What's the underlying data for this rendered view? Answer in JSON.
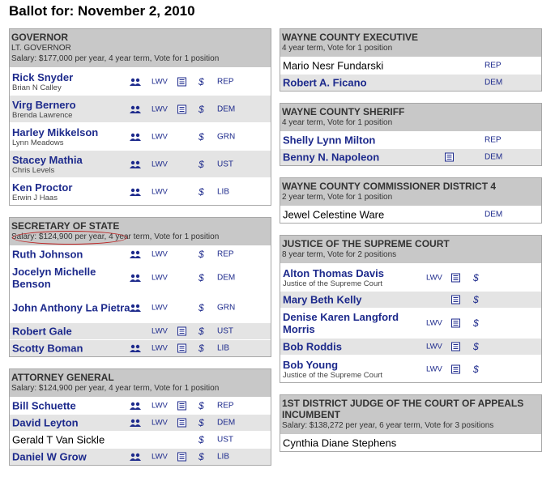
{
  "page_title": "Ballot for: November 2, 2010",
  "colors": {
    "link": "#1d2a8c",
    "header_bg": "#c8c8c8",
    "alt_row": "#e4e4e4",
    "annotation": "#bb2222"
  },
  "icons": {
    "people": "people-icon",
    "doc": "document-icon",
    "dollar": "$",
    "lwv": "LWV"
  },
  "left": [
    {
      "title": "GOVERNOR",
      "title2": "LT. GOVERNOR",
      "info": "Salary: $177,000 per year, 4 year term, Vote for 1 position",
      "candidates": [
        {
          "name": "Rick Snyder",
          "running": "Brian N Calley",
          "party": "REP",
          "lwv": "LWV",
          "dollar": "$"
        },
        {
          "name": "Virg Bernero",
          "running": "Brenda Lawrence",
          "party": "DEM",
          "lwv": "LWV",
          "dollar": "$"
        },
        {
          "name": "Harley Mikkelson",
          "running": "Lynn Meadows",
          "party": "GRN",
          "lwv": "LWV",
          "dollar": "$"
        },
        {
          "name": "Stacey Mathia",
          "running": "Chris Levels",
          "party": "UST",
          "lwv": "LWV",
          "dollar": "$"
        },
        {
          "name": "Ken Proctor",
          "running": "Erwin J Haas",
          "party": "LIB",
          "lwv": "LWV",
          "dollar": "$"
        }
      ]
    },
    {
      "title": "SECRETARY OF STATE",
      "info": "Salary: $124,900 per year, 4 year term, Vote for 1 position",
      "candidates": [
        {
          "name": "Ruth Johnson",
          "party": "REP",
          "lwv": "LWV",
          "dollar": "$"
        },
        {
          "name": "Jocelyn Michelle Benson",
          "party": "DEM",
          "lwv": "LWV",
          "dollar": "$"
        },
        {
          "name": "John Anthony La Pietra",
          "party": "GRN",
          "lwv": "LWV",
          "dollar": "$"
        },
        {
          "name": "Robert Gale",
          "party": "UST",
          "lwv": "LWV",
          "dollar": "$"
        },
        {
          "name": "Scotty Boman",
          "party": "LIB",
          "lwv": "LWV",
          "dollar": "$"
        }
      ]
    },
    {
      "title": "ATTORNEY GENERAL",
      "info": "Salary: $124,900 per year, 4 year term, Vote for 1 position",
      "candidates": [
        {
          "name": "Bill Schuette",
          "party": "REP",
          "lwv": "LWV",
          "dollar": "$"
        },
        {
          "name": "David Leyton",
          "party": "DEM",
          "lwv": "LWV",
          "dollar": "$"
        },
        {
          "name": "Gerald T Van Sickle",
          "party": "UST",
          "dollar": "$"
        },
        {
          "name": "Daniel W Grow",
          "party": "LIB",
          "lwv": "LWV",
          "dollar": "$"
        }
      ]
    }
  ],
  "right": [
    {
      "title": "WAYNE COUNTY EXECUTIVE",
      "info": "4 year term, Vote for 1 position",
      "candidates": [
        {
          "name": "Mario Nesr Fundarski",
          "party": "REP"
        },
        {
          "name": "Robert A. Ficano",
          "party": "DEM"
        }
      ]
    },
    {
      "title": "WAYNE COUNTY SHERIFF",
      "info": "4 year term, Vote for 1 position",
      "candidates": [
        {
          "name": "Shelly Lynn Milton",
          "party": "REP"
        },
        {
          "name": "Benny N. Napoleon",
          "party": "DEM"
        }
      ]
    },
    {
      "title": "WAYNE COUNTY COMMISSIONER DISTRICT 4",
      "info": "2 year term, Vote for 1 position",
      "candidates": [
        {
          "name": "Jewel Celestine Ware",
          "party": "DEM"
        }
      ]
    },
    {
      "title": "JUSTICE OF THE SUPREME COURT",
      "info": "8 year term, Vote for 2 positions",
      "candidates": [
        {
          "name": "Alton Thomas Davis",
          "running": "Justice of the Supreme Court",
          "lwv": "LWV",
          "dollar": "$"
        },
        {
          "name": "Mary Beth Kelly",
          "dollar": "$"
        },
        {
          "name": "Denise Karen Langford Morris",
          "lwv": "LWV",
          "dollar": "$"
        },
        {
          "name": "Bob Roddis",
          "lwv": "LWV",
          "dollar": "$"
        },
        {
          "name": "Bob Young",
          "running": "Justice of the Supreme Court",
          "lwv": "LWV",
          "dollar": "$"
        }
      ]
    },
    {
      "title": "1ST DISTRICT JUDGE OF THE COURT OF APPEALS INCUMBENT",
      "info": "Salary: $138,272 per year, 6 year term, Vote for 3 positions",
      "candidates": [
        {
          "name": "Cynthia Diane Stephens"
        }
      ]
    }
  ]
}
